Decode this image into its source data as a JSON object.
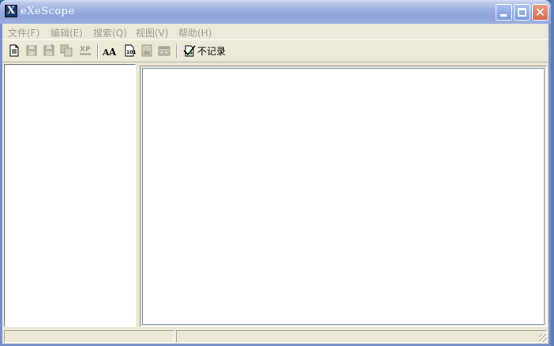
{
  "window": {
    "title": "eXeScope",
    "icon_letter": "X"
  },
  "title_buttons": {
    "close_glyph": "✕"
  },
  "menu": [
    {
      "label": "文件(F)"
    },
    {
      "label": "编辑(E)"
    },
    {
      "label": "搜索(Q)"
    },
    {
      "label": "视图(V)"
    },
    {
      "label": "帮助(H)"
    }
  ],
  "toolbar": {
    "icons": [
      "new-document-icon",
      "save-icon",
      "save-as-icon",
      "copy-icon",
      "xp-icon",
      "font-icon",
      "hex-icon",
      "image-icon",
      "dialog-icon",
      "record-icon"
    ],
    "no_record_label": "不记录"
  },
  "statusbar": {
    "panel1": "",
    "panel2": ""
  },
  "colors": {
    "title_gradient": "#9cb0e0",
    "face": "#ece9d8",
    "disabled_text": "#a09c8c"
  }
}
